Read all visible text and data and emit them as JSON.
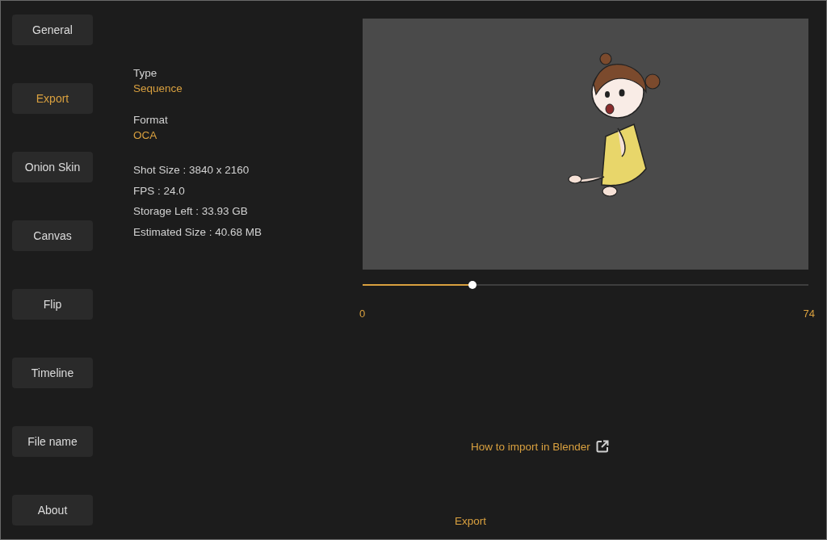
{
  "sidebar": {
    "items": [
      {
        "label": "General",
        "selected": false
      },
      {
        "label": "Export",
        "selected": true
      },
      {
        "label": "Onion Skin",
        "selected": false
      },
      {
        "label": "Canvas",
        "selected": false
      },
      {
        "label": "Flip",
        "selected": false
      },
      {
        "label": "Timeline",
        "selected": false
      },
      {
        "label": "File name",
        "selected": false
      },
      {
        "label": "About",
        "selected": false
      }
    ]
  },
  "settings": [
    {
      "label": "Type",
      "value": "Sequence"
    },
    {
      "label": "Format",
      "value": "OCA"
    }
  ],
  "details": [
    "Shot Size :  3840 x 2160",
    "FPS :  24.0",
    "Storage Left : 33.93 GB",
    "Estimated Size : 40.68 MB"
  ],
  "timeline": {
    "level": 0.246,
    "start": "0",
    "end": "74"
  },
  "help_link": "How to import in Blender",
  "export_button": "Export"
}
